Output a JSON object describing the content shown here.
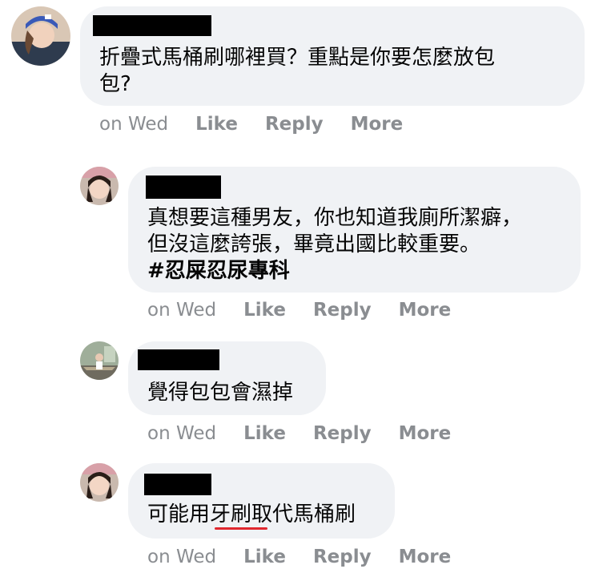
{
  "comments": [
    {
      "text": "折疊式馬桶刷哪裡買？重點是你要怎麼放包\n包?",
      "time": "on Wed",
      "like": "Like",
      "reply": "Reply",
      "more": "More"
    },
    {
      "text": "真想要這種男友，你也知道我廁所潔癖，\n但沒這麼誇張，畢竟出國比較重要。",
      "tag": "#忍屎忍尿專科",
      "time": "on Wed",
      "like": "Like",
      "reply": "Reply",
      "more": "More"
    },
    {
      "text": "覺得包包會濕掉",
      "time": "on Wed",
      "like": "Like",
      "reply": "Reply",
      "more": "More"
    },
    {
      "text": "可能用牙刷取代馬桶刷",
      "time": "on Wed",
      "like": "Like",
      "reply": "Reply",
      "more": "More"
    }
  ],
  "colors": {
    "bubble": "#f0f2f5",
    "meta": "#8a8d91",
    "highlight_underline": "#e0282f"
  }
}
